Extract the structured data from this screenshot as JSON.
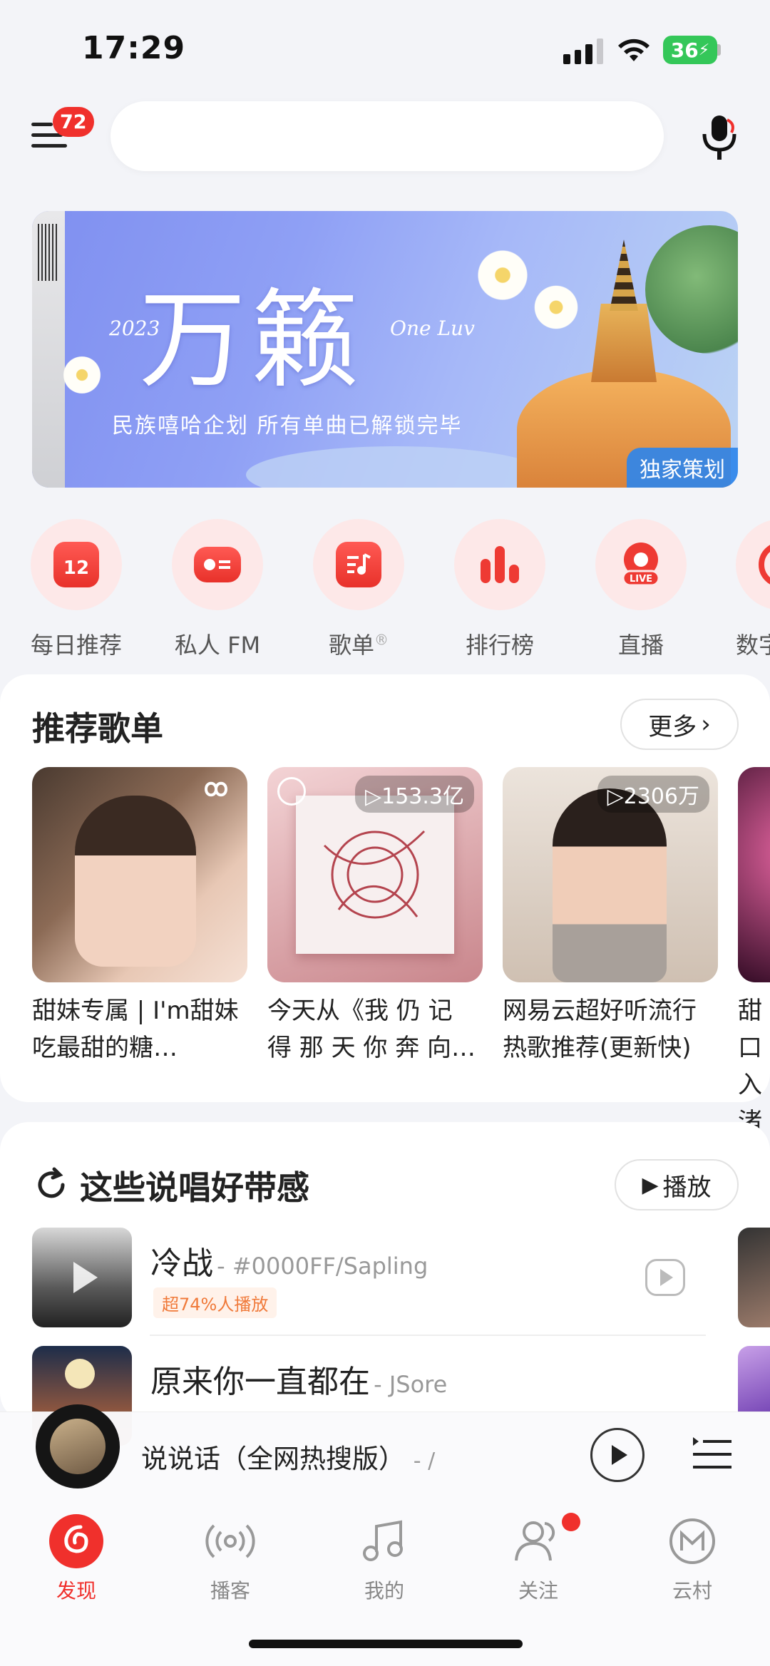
{
  "status_bar": {
    "time": "17:29",
    "battery": "36"
  },
  "header": {
    "menu_badge": "72",
    "search_placeholder": ""
  },
  "banner": {
    "title": "万籁",
    "year": "2023",
    "one_luv": "One Luv",
    "subtitle": "民族嘻哈企划 所有单曲已解锁完毕",
    "tag": "独家策划"
  },
  "quick_entries": [
    {
      "label": "每日推荐",
      "icon": "calendar-icon",
      "icon_text": "12"
    },
    {
      "label": "私人 FM",
      "icon": "radio-icon"
    },
    {
      "label": "歌单",
      "icon": "playlist-icon",
      "sup": "®"
    },
    {
      "label": "排行榜",
      "icon": "chart-icon"
    },
    {
      "label": "直播",
      "icon": "live-icon"
    },
    {
      "label": "数字",
      "icon": "digital-album-icon"
    }
  ],
  "recommended": {
    "title": "推荐歌单",
    "more_label": "更多",
    "playlists": [
      {
        "title": "甜妹专属 | I'm甜妹 吃最甜的糖…",
        "count": ""
      },
      {
        "title": "今天从《我 仍 记 得 那 天 你 奔 向…",
        "count": "153.3亿"
      },
      {
        "title": "网易云超好听流行热歌推荐(更新快)",
        "count": "2306万"
      },
      {
        "title": "甜口入渚",
        "count": ""
      }
    ]
  },
  "rap_section": {
    "title": "这些说唱好带感",
    "play_label": "播放",
    "songs": [
      {
        "name": "冷战",
        "artist": "- #0000FF/Sapling",
        "tag": "超74%人播放"
      },
      {
        "name": "原来你一直都在",
        "artist": "- JSore",
        "tag": ""
      }
    ]
  },
  "player": {
    "title": "说说话（全网热搜版）",
    "artist": "- /"
  },
  "tabs": [
    {
      "label": "发现",
      "icon": "netease-logo-icon",
      "active": true
    },
    {
      "label": "播客",
      "icon": "podcast-icon",
      "active": false
    },
    {
      "label": "我的",
      "icon": "music-note-icon",
      "active": false
    },
    {
      "label": "关注",
      "icon": "follow-icon",
      "active": false
    },
    {
      "label": "云村",
      "icon": "cloud-village-icon",
      "active": false
    }
  ],
  "colors": {
    "accent": "#f0302c",
    "banner_tag": "#2f86ea"
  }
}
